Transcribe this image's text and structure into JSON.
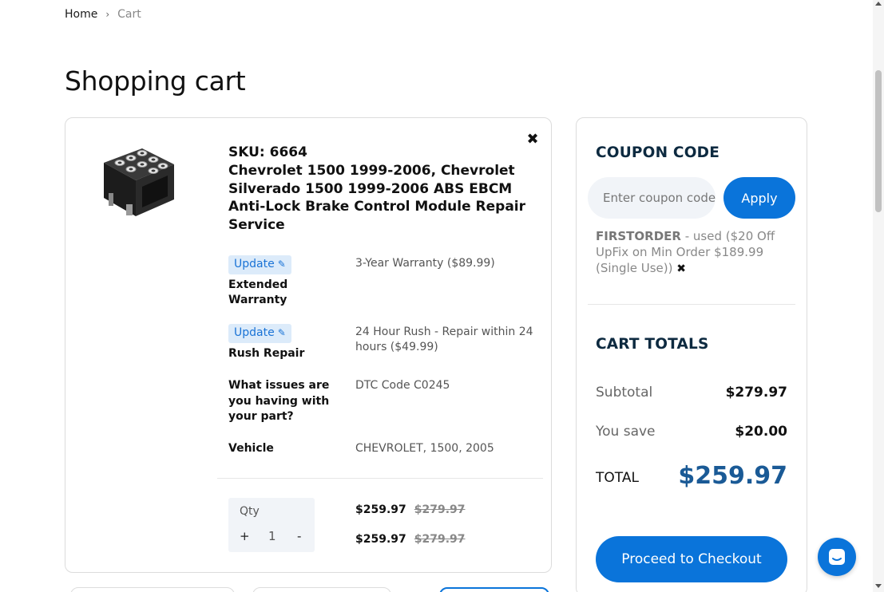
{
  "breadcrumb": {
    "home": "Home",
    "separator": "›",
    "current": "Cart"
  },
  "page_title": "Shopping cart",
  "cart_item": {
    "sku": "SKU: 6664",
    "name": "Chevrolet 1500 1999-2006, Chevrolet Silverado 1500 1999-2006 ABS EBCM Anti-Lock Brake Control Module Repair Service",
    "remove_icon": "close-icon",
    "update_label": "Update",
    "options": [
      {
        "label": "Extended Warranty",
        "value": "3-Year Warranty ($89.99)"
      },
      {
        "label": "Rush Repair",
        "value": "24 Hour Rush - Repair within 24 hours ($49.99)"
      },
      {
        "label": "What issues are you having with your part?",
        "value": "DTC Code C0245"
      },
      {
        "label": "Vehicle",
        "value": "CHEVROLET, 1500, 2005"
      }
    ],
    "qty_label": "Qty",
    "qty_plus": "+",
    "qty_value": "1",
    "qty_minus": "-",
    "prices": [
      {
        "now": "$259.97",
        "was": "$279.97"
      },
      {
        "now": "$259.97",
        "was": "$279.97"
      }
    ]
  },
  "coupon": {
    "title": "COUPON CODE",
    "placeholder": "Enter coupon code",
    "apply_label": "Apply",
    "applied_code": "FIRSTORDER",
    "applied_text": " - used ($20 Off UpFix on Min Order $189.99 (Single Use)) ",
    "remove_glyph": "✖"
  },
  "totals": {
    "title": "CART TOTALS",
    "subtotal_label": "Subtotal",
    "subtotal_value": "$279.97",
    "save_label": "You save",
    "save_value": "$20.00",
    "total_label": "TOTAL",
    "total_value": "$259.97",
    "checkout_label": "Proceed to Checkout"
  },
  "colors": {
    "accent": "#0a74da",
    "total": "#1a5a96",
    "heading": "#0d2a40",
    "update_bg": "#dcebfa"
  }
}
